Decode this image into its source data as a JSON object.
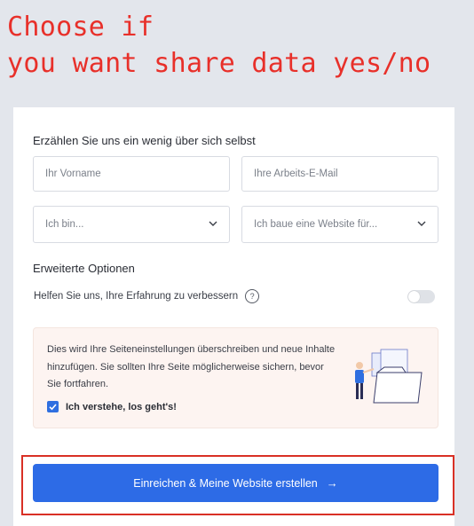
{
  "annotation": {
    "text": "Choose if\nyou want share data yes/no"
  },
  "form": {
    "section_title": "Erzählen Sie uns ein wenig über sich selbst",
    "first_name_placeholder": "Ihr Vorname",
    "email_placeholder": "Ihre Arbeits-E-Mail",
    "role_select": "Ich bin...",
    "site_select": "Ich baue eine Website für...",
    "advanced_title": "Erweiterte Optionen",
    "help_label": "Helfen Sie uns, Ihre Erfahrung zu verbessern",
    "help_icon": "?",
    "help_toggle_on": false,
    "notice_text": "Dies wird Ihre Seiteneinstellungen überschreiben und neue Inhalte hinzufügen. Sie sollten Ihre Seite möglicherweise sichern, bevor Sie fortfahren.",
    "confirm_label": "Ich verstehe, los geht's!",
    "confirm_checked": true,
    "submit_label": "Einreichen & Meine Website erstellen",
    "submit_arrow": "→"
  },
  "colors": {
    "accent": "#2d6be6",
    "annotation": "#e8302a",
    "notice_bg": "#fdf4f1"
  }
}
